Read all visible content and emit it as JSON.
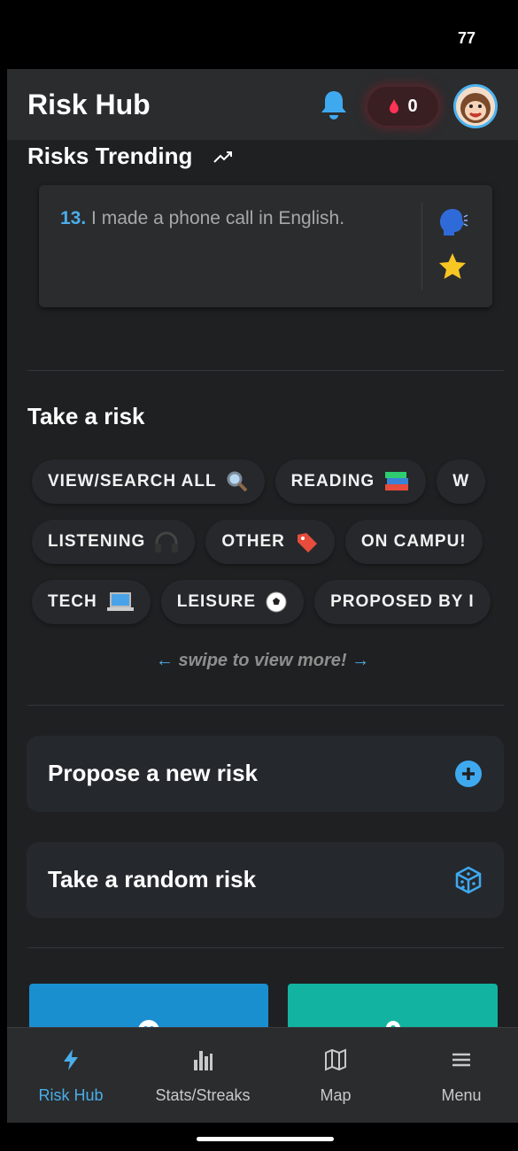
{
  "status_bar": {
    "battery": "77"
  },
  "header": {
    "title": "Risk Hub",
    "streak_count": "0"
  },
  "trending": {
    "title": "Risks Trending",
    "item": {
      "number": "13.",
      "text": "I made a phone call in English."
    }
  },
  "take_risk": {
    "title": "Take a risk",
    "row1": [
      "VIEW/SEARCH ALL",
      "READING",
      "W"
    ],
    "row2": [
      "LISTENING",
      "OTHER",
      "ON CAMPU!"
    ],
    "row3": [
      "TECH",
      "LEISURE",
      "PROPOSED BY I"
    ],
    "swipe_hint": "swipe to view more!",
    "arrow_left": "←",
    "arrow_right": "→"
  },
  "actions": {
    "propose": "Propose a new risk",
    "random": "Take a random risk"
  },
  "nav": {
    "items": [
      {
        "label": "Risk Hub",
        "icon": "lightning-icon"
      },
      {
        "label": "Stats/Streaks",
        "icon": "bar-chart-icon"
      },
      {
        "label": "Map",
        "icon": "map-icon"
      },
      {
        "label": "Menu",
        "icon": "menu-icon"
      }
    ]
  },
  "colors": {
    "accent": "#4aaee8",
    "tile_blue": "#1a8fd0",
    "tile_teal": "#13b3a2",
    "bg": "#1f2022"
  }
}
